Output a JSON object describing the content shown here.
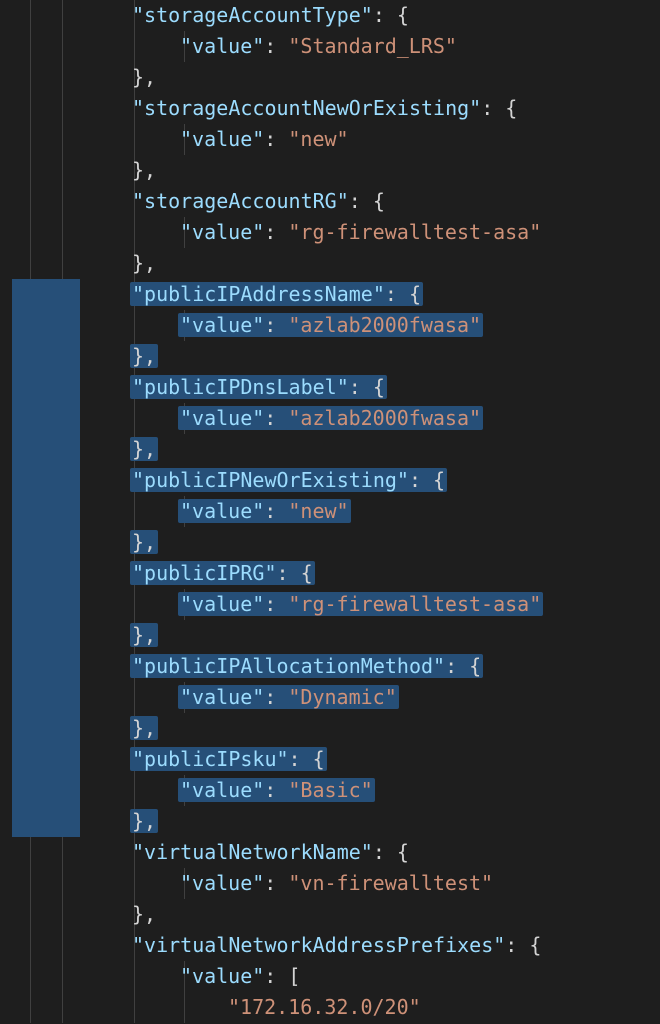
{
  "code": {
    "valueKey": "\"value\"",
    "openObj": "{",
    "closeObj": "}",
    "closeObjComma": "},",
    "colon": ": ",
    "openArr": "[",
    "entries": [
      {
        "key": "\"storageAccountType\"",
        "val": "\"Standard_LRS\"",
        "sel": false
      },
      {
        "key": "\"storageAccountNewOrExisting\"",
        "val": "\"new\"",
        "sel": false
      },
      {
        "key": "\"storageAccountRG\"",
        "val": "\"rg-firewalltest-asa\"",
        "sel": false
      },
      {
        "key": "\"publicIPAddressName\"",
        "val": "\"azlab2000fwasa\"",
        "sel": true
      },
      {
        "key": "\"publicIPDnsLabel\"",
        "val": "\"azlab2000fwasa\"",
        "sel": true
      },
      {
        "key": "\"publicIPNewOrExisting\"",
        "val": "\"new\"",
        "sel": true
      },
      {
        "key": "\"publicIPRG\"",
        "val": "\"rg-firewalltest-asa\"",
        "sel": true
      },
      {
        "key": "\"publicIPAllocationMethod\"",
        "val": "\"Dynamic\"",
        "sel": true
      },
      {
        "key": "\"publicIPsku\"",
        "val": "\"Basic\"",
        "sel": true
      },
      {
        "key": "\"virtualNetworkName\"",
        "val": "\"vn-firewalltest\"",
        "sel": false
      }
    ],
    "arrayEntry": {
      "key": "\"virtualNetworkAddressPrefixes\"",
      "item0": "\"172.16.32.0/20\""
    }
  }
}
